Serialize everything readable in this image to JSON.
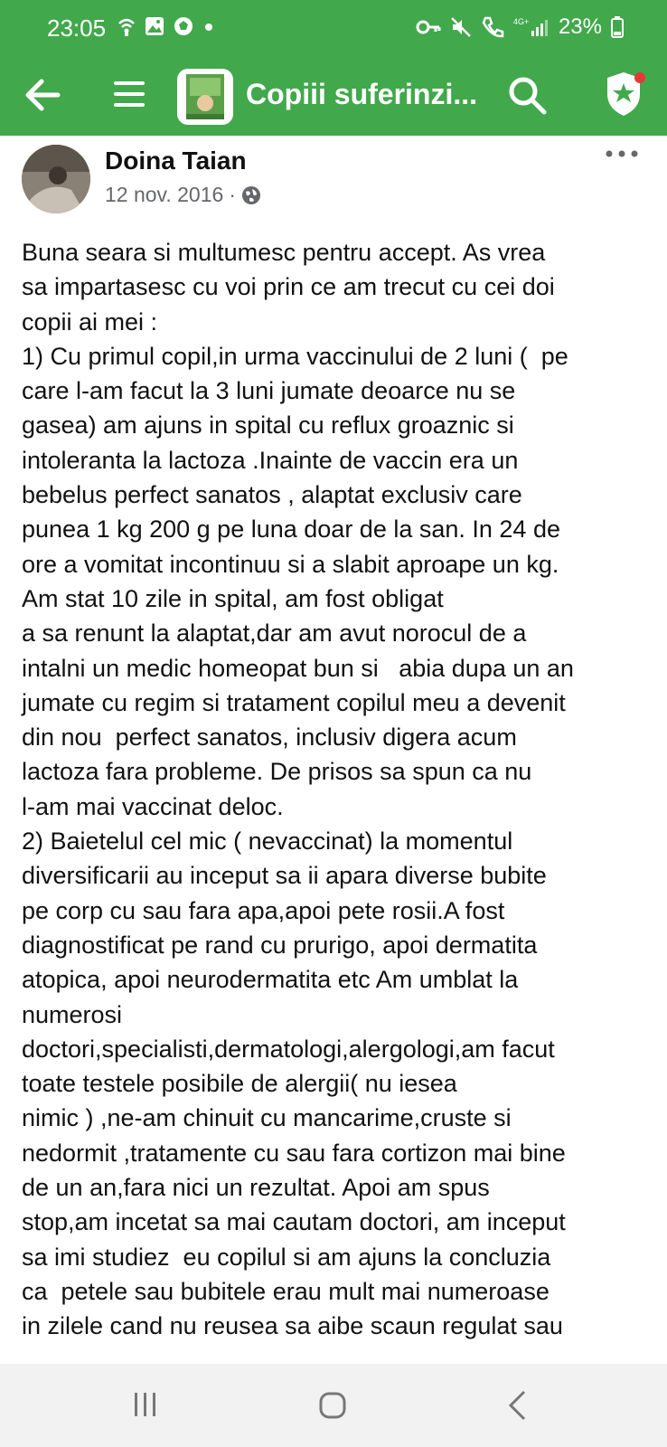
{
  "status_bar": {
    "time": "23:05",
    "battery": "23%",
    "network": "4G+"
  },
  "app_bar": {
    "group_title": "Copiii suferinzi..."
  },
  "post": {
    "author": "Doina Taian",
    "date": "12 nov. 2016",
    "separator": "·",
    "text": "Buna seara si multumesc pentru accept. As vrea\nsa impartasesc cu voi prin ce am trecut cu cei doi\ncopii ai mei :\n1) Cu primul copil,in urma vaccinului de 2 luni (  pe\ncare l-am facut la 3 luni jumate deoarce nu se\ngasea) am ajuns in spital cu reflux groaznic si\nintoleranta la lactoza .Inainte de vaccin era un\nbebelus perfect sanatos , alaptat exclusiv care\npunea 1 kg 200 g pe luna doar de la san. In 24 de\nore a vomitat incontinuu si a slabit aproape un kg.\nAm stat 10 zile in spital, am fost obligat\na sa renunt la alaptat,dar am avut norocul de a\nintalni un medic homeopat bun si   abia dupa un an\njumate cu regim si tratament copilul meu a devenit\ndin nou  perfect sanatos, inclusiv digera acum\nlactoza fara probleme. De prisos sa spun ca nu\nl-am mai vaccinat deloc.\n2) Baietelul cel mic ( nevaccinat) la momentul\ndiversificarii au inceput sa ii apara diverse bubite\npe corp cu sau fara apa,apoi pete rosii.A fost\ndiagnostificat pe rand cu prurigo, apoi dermatita\natopica, apoi neurodermatita etc Am umblat la\nnumerosi\ndoctori,specialisti,dermatologi,alergologi,am facut\ntoate testele posibile de alergii( nu iesea\nnimic ) ,ne-am chinuit cu mancarime,cruste si\nnedormit ,tratamente cu sau fara cortizon mai bine\nde un an,fara nici un rezultat. Apoi am spus\nstop,am incetat sa mai cautam doctori, am inceput\nsa imi studiez  eu copilul si am ajuns la concluzia\nca  petele sau bubitele erau mult mai numeroase\nin zilele cand nu reusea sa aibe scaun regulat sau"
  },
  "colors": {
    "header_green": "#42a84c",
    "badge_red": "#e53935"
  },
  "icons": [
    "wifi-icon",
    "image-icon",
    "ball-icon",
    "key-icon",
    "mute-icon",
    "call-icon",
    "signal-icon",
    "battery-icon",
    "back-arrow-icon",
    "menu-icon",
    "search-icon",
    "shield-star-icon",
    "more-icon",
    "globe-icon",
    "recent-apps-icon",
    "home-icon",
    "nav-back-icon"
  ]
}
